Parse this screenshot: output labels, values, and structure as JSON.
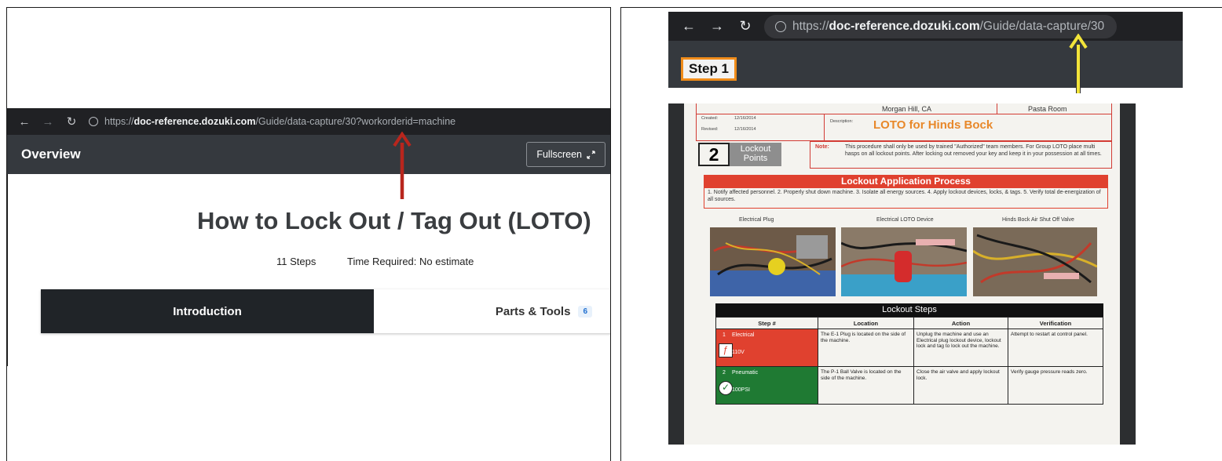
{
  "left": {
    "browser": {
      "url_scheme": "https://",
      "url_host": "doc-reference.dozuki.com",
      "url_path": "/Guide/data-capture/30?workorderid=machine"
    },
    "header": {
      "title": "Overview",
      "fullscreen_label": "Fullscreen",
      "fullscreen_icon": "expand-icon"
    },
    "guide": {
      "title": "How to Lock Out / Tag Out (LOTO)",
      "steps": "11 Steps",
      "time_required": "Time Required: No estimate"
    },
    "tabs": [
      {
        "label": "Introduction",
        "active": true
      },
      {
        "label": "Parts & Tools",
        "badge": "6",
        "active": false
      }
    ],
    "annotation_color": "#b8261d"
  },
  "right": {
    "browser": {
      "url_scheme": "https://",
      "url_host": "doc-reference.dozuki.com",
      "url_path": "/Guide/data-capture/30"
    },
    "step_badge": "Step 1",
    "step_badge_border": "#f08c1a",
    "annotation_color": "#f2e43a",
    "document": {
      "header_location": "Morgan Hill, CA",
      "header_room": "Pasta Room",
      "created_label": "Created:",
      "created_date": "12/16/2014",
      "revised_label": "Revised:",
      "revised_date": "12/16/2014",
      "description_label": "Description:",
      "doc_title": "LOTO for Hinds Bock",
      "lockout_points_num": "2",
      "lockout_points_label": "Lockout Points",
      "note_label": "Note:",
      "note_text": "This procedure shall only be used by trained \"Authorized\" team members. For Group LOTO place multi hasps on all lockout points. After locking out removed your key and keep it in your possession at all times.",
      "process_title": "Lockout Application Process",
      "process_text": "1. Notify affected personnel. 2. Properly shut down machine. 3. Isolate all energy sources. 4. Apply lockout devices, locks, & tags. 5. Verify total de-energization of all sources.",
      "photo_captions": [
        "Electrical Plug",
        "Electrical LOTO Device",
        "Hinds Bock Air Shut Off Valve"
      ],
      "steps_title": "Lockout Steps",
      "columns": [
        "Step #",
        "Location",
        "Action",
        "Verification"
      ],
      "rows": [
        {
          "num": "1",
          "kind": "Electrical",
          "value": "110V",
          "color": "#e0412f",
          "icon": "lightning-icon",
          "location": "The E-1 Plug is located on the side of the machine.",
          "action": "Unplug the machine and use an Electrical plug lockout device, lockout lock and tag to lock out the machine.",
          "verification": "Attempt to restart at control panel."
        },
        {
          "num": "2",
          "kind": "Pneumatic",
          "value": "100PSI",
          "color": "#1f7a33",
          "icon": "gauge-icon",
          "location": "The P-1 Ball Valve is located on the side of the machine.",
          "action": "Close the air valve and apply lockout lock.",
          "verification": "Verify gauge pressure reads zero."
        }
      ]
    }
  }
}
